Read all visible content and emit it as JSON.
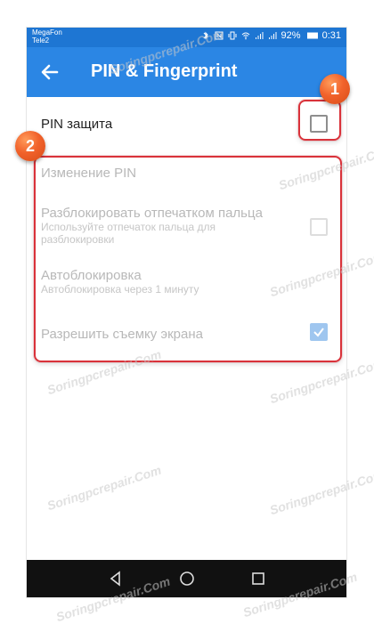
{
  "statusbar": {
    "carrier1": "MegaFon",
    "carrier2": "Tele2",
    "battery": "92%",
    "time": "0:31"
  },
  "appbar": {
    "title": "PIN & Fingerprint",
    "back_icon": "arrow-left-icon"
  },
  "settings": [
    {
      "label": "PIN защита",
      "sub": "",
      "checked": false,
      "enabled": true
    },
    {
      "label": "Изменение PIN",
      "sub": "",
      "enabled": false
    },
    {
      "label": "Разблокировать отпечатком пальца",
      "sub": "Используйте отпечаток пальца для разблокировки",
      "checked": false,
      "enabled": false
    },
    {
      "label": "Автоблокировка",
      "sub": "Автоблокировка через 1 минуту",
      "enabled": false
    },
    {
      "label": "Разрешить съемку экрана",
      "sub": "",
      "checked": true,
      "enabled": false
    }
  ],
  "callouts": [
    "1",
    "2"
  ],
  "watermark": "Soringpcrepair.Com",
  "colors": {
    "statusbar": "#1e76d3",
    "appbar": "#2b86e4",
    "callout": "#d9323a",
    "badge": "#f1622b"
  }
}
